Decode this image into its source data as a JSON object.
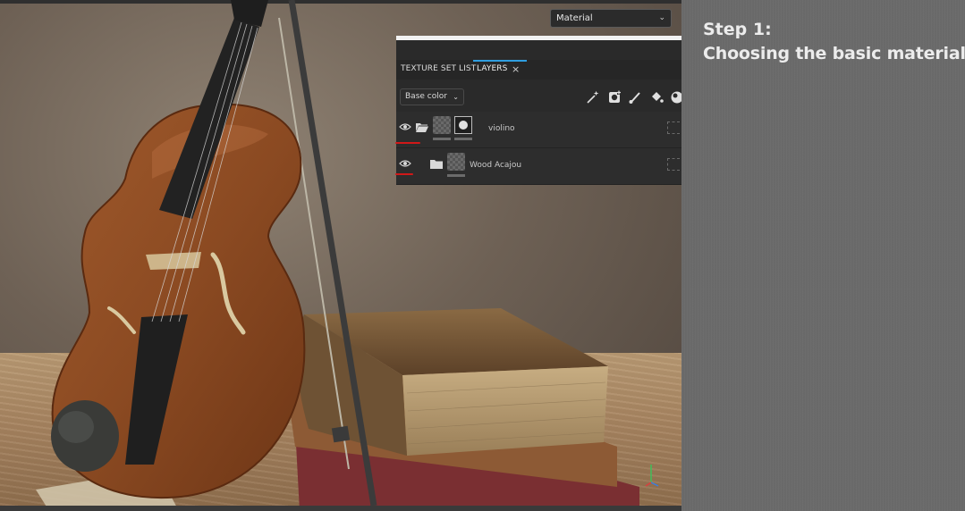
{
  "viewport": {
    "material_dropdown": {
      "value": "Material",
      "icon": "chevron-down-icon"
    }
  },
  "layers_panel": {
    "tabs": [
      {
        "label": "TEXTURE SET LIST",
        "active": false
      },
      {
        "label": "LAYERS",
        "active": true
      }
    ],
    "close_icon": "close-icon",
    "channel_dropdown": {
      "value": "Base color",
      "icon": "chevron-down-icon"
    },
    "tools": [
      "magic-wand-icon",
      "add-mask-icon",
      "paint-brush-icon",
      "fill-bucket-icon",
      "material-sphere-icon"
    ],
    "layers": [
      {
        "name": "violino",
        "type": "folder-open",
        "visible": true,
        "has_mask": true
      },
      {
        "name": "Wood Acajou",
        "type": "folder",
        "visible": true,
        "has_mask": false
      }
    ]
  },
  "info": {
    "step_title": "Step 1:",
    "step_subtitle": "Choosing the basic material"
  },
  "colors": {
    "panel_bg": "#2a2a2a",
    "accent": "#2f9ee0",
    "annotation": "#d01818",
    "info_bg": "#6b6b6b",
    "info_text": "#ececec"
  }
}
